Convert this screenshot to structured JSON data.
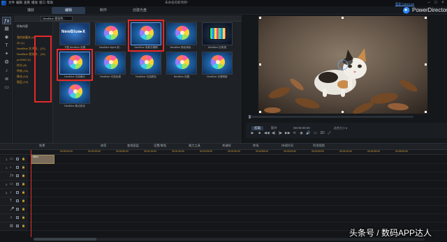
{
  "menubar": {
    "items": [
      "文件",
      "编辑",
      "查看",
      "播放",
      "窗口",
      "帮助"
    ],
    "document_title": "未命名的新项目*"
  },
  "window_controls": {
    "minimize": "–",
    "maximize": "□",
    "close": "×"
  },
  "mode_tabs": [
    {
      "label": "捕获",
      "active": false
    },
    {
      "label": "编辑",
      "active": true
    },
    {
      "label": "制作",
      "active": false
    },
    {
      "label": "创建光盘",
      "active": false
    }
  ],
  "brand": {
    "name": "PowerDirector",
    "account_link": "登录 CyberLink"
  },
  "tools": [
    {
      "icon": "fx-icon",
      "glyph": "ƒx",
      "active": true
    },
    {
      "icon": "media-icon",
      "glyph": "▦",
      "active": false
    },
    {
      "icon": "transition-icon",
      "glyph": "◆",
      "active": false
    },
    {
      "icon": "title-icon",
      "glyph": "T",
      "active": false
    },
    {
      "icon": "pip-icon",
      "glyph": "✦",
      "active": false
    },
    {
      "icon": "particle-icon",
      "glyph": "❂",
      "active": false
    },
    {
      "icon": "audio-icon",
      "glyph": "♪",
      "active": false
    },
    {
      "icon": "chapter-icon",
      "glyph": "≣",
      "active": false
    },
    {
      "icon": "subtitle-icon",
      "glyph": "▭",
      "active": false
    }
  ],
  "library": {
    "filter_dropdown": "NewBlue 视觉特...",
    "categories": [
      {
        "label": "所有内容",
        "head": true
      },
      {
        "label": "我的收藏夹 (0)",
        "head": false
      },
      {
        "label": "3D (1)",
        "head": false
      },
      {
        "label": "NewBlue 艺术效... (21)",
        "head": false
      },
      {
        "label": "NewBlue 视觉特... (15)",
        "head": false
      },
      {
        "label": "proDAD (1)",
        "head": false
      },
      {
        "label": "样式 (8)",
        "head": false
      },
      {
        "label": "特效 (15)",
        "head": false
      },
      {
        "label": "移动 (15)",
        "head": false
      },
      {
        "label": "图层 (19)",
        "head": false
      }
    ],
    "effects": [
      {
        "label": "下载 NewBlue 效果",
        "kind": "logo",
        "logo_text": "NewBlue▸X",
        "highlighted": false
      },
      {
        "label": "NewBlue Alpha 剪...",
        "kind": "flower",
        "highlighted": false
      },
      {
        "label": "NewBlue 背景去模糊",
        "kind": "flower",
        "highlighted": true
      },
      {
        "label": "NewBlue 颜色调色...",
        "kind": "flower",
        "highlighted": false
      },
      {
        "label": "NewBlue 旧电视",
        "kind": "tv",
        "highlighted": false
      },
      {
        "label": "NewBlue 可选曝光",
        "kind": "flower",
        "highlighted": true
      },
      {
        "label": "NewBlue 可选色调",
        "kind": "flower",
        "highlighted": false
      },
      {
        "label": "NewBlue 可选颜色",
        "kind": "flower",
        "highlighted": false
      },
      {
        "label": "NewBlue 拓展",
        "kind": "flower",
        "highlighted": false
      },
      {
        "label": "NewBlue 光晕阴影",
        "kind": "flower",
        "highlighted": false
      },
      {
        "label": "NewBlue 焦点锐化",
        "kind": "flower",
        "highlighted": false
      }
    ]
  },
  "player": {
    "mode_clip": "剪辑",
    "mode_movie": "影片",
    "timecode": "00:00:00:00",
    "fit": "适合大小 ▾",
    "controls": [
      "▶",
      "■",
      "◀◀",
      "◀|",
      "|▶",
      "▶▶",
      "⟲",
      "◉",
      "🔊",
      "▭",
      "3D",
      "⤢"
    ]
  },
  "timeline_toolbar": [
    "效果",
    "修剪",
    "查找图层",
    "设置/增强",
    "威力工具",
    "关键帧",
    "转场",
    "持续时间",
    "利用视频"
  ],
  "ruler": [
    "00:00:00:00",
    "00:00:25:00",
    "00:00:50:00",
    "00:01:15:00",
    "00:01:40:00",
    "00:02:05:00",
    "00:02:30:00",
    "00:02:55:00",
    "00:03:20:00",
    "00:03:45:00",
    "00:04:10:00",
    "00:04:35:00",
    "00:05:00:00"
  ],
  "tracks": [
    {
      "label": "1.",
      "icon": "video-track-icon",
      "glyph": "▭"
    },
    {
      "label": "1.",
      "icon": "audio-track-icon",
      "glyph": "♪"
    },
    {
      "label": "",
      "icon": "fx-track-icon",
      "glyph": "ƒx"
    },
    {
      "label": "2.",
      "icon": "video-track-icon",
      "glyph": "▭"
    },
    {
      "label": "2.",
      "icon": "audio-track-icon",
      "glyph": "♪"
    },
    {
      "label": "",
      "icon": "title-track-icon",
      "glyph": "T"
    },
    {
      "label": "",
      "icon": "voice-track-icon",
      "glyph": "🎤"
    },
    {
      "label": "",
      "icon": "music-track-icon",
      "glyph": "♫"
    },
    {
      "label": "",
      "icon": "subtitle-track-icon",
      "glyph": "▤"
    }
  ],
  "clip": {
    "label": "kitten"
  },
  "watermark": "头条号 / 数码APP达人",
  "colors": {
    "accent": "#2e8bff",
    "highlight_box": "#e5282a",
    "category_text": "#d3962a",
    "playhead": "#e8322f"
  }
}
